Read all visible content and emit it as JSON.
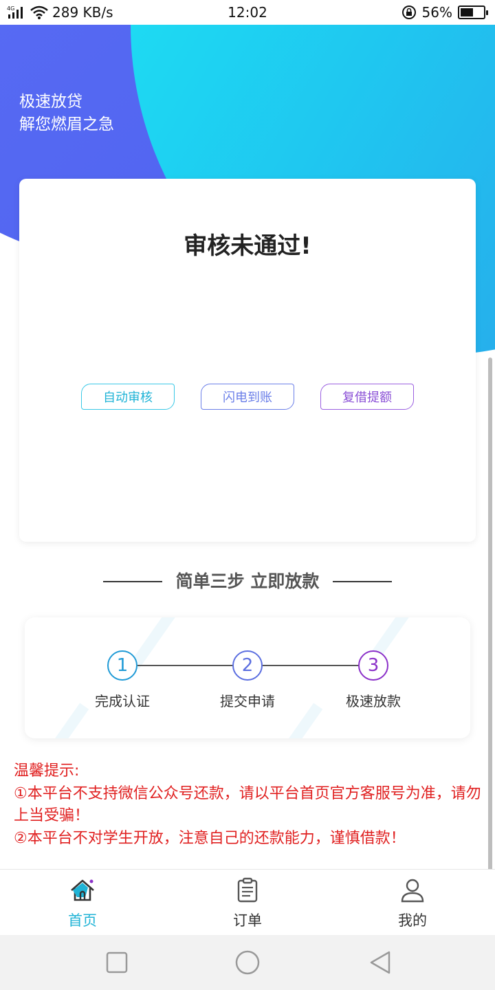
{
  "status_bar": {
    "network_type": "4G",
    "speed": "289 KB/s",
    "time": "12:02",
    "battery_percent": "56%",
    "battery_level": 0.56
  },
  "hero": {
    "slogan_line1": "极速放贷",
    "slogan_line2": "解您燃眉之急",
    "colors": {
      "left": "#5b6ef5",
      "right_start": "#1de8f5",
      "right_end": "#2c9be8"
    }
  },
  "main_card": {
    "title": "审核未通过!",
    "tags": [
      "自动审核",
      "闪电到账",
      "复借提额"
    ]
  },
  "section": {
    "title": "简单三步 立即放款"
  },
  "steps": [
    {
      "number": "1",
      "label": "完成认证",
      "color": "#1f9ad6"
    },
    {
      "number": "2",
      "label": "提交申请",
      "color": "#5b6ee0"
    },
    {
      "number": "3",
      "label": "极速放款",
      "color": "#8a2fc8"
    }
  ],
  "notice": {
    "heading": "温馨提示:",
    "items": [
      "①本平台不支持微信公众号还款，请以平台首页官方客服号为准，请勿上当受骗！",
      "②本平台不对学生开放，注意自己的还款能力，谨慎借款！"
    ]
  },
  "tab_bar": {
    "items": [
      {
        "label": "首页",
        "icon": "home-icon",
        "active": true
      },
      {
        "label": "订单",
        "icon": "order-icon",
        "active": false
      },
      {
        "label": "我的",
        "icon": "user-icon",
        "active": false
      }
    ],
    "active_color": "#1fb3d6",
    "inactive_color": "#333333"
  },
  "system_nav": [
    "recent-apps-icon",
    "home-circle-icon",
    "back-icon"
  ]
}
